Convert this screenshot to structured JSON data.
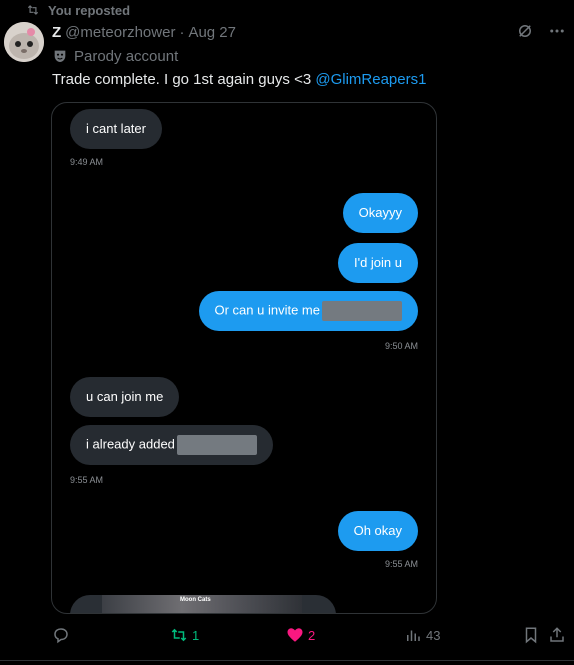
{
  "repost": {
    "label": "You reposted"
  },
  "author": {
    "display_name": "Z",
    "handle": "@meteorzhower",
    "separator": "·",
    "date": "Aug 27",
    "badge": "Parody account"
  },
  "post": {
    "text": "Trade complete. I go 1st again guys <3 ",
    "mention": "@GlimReapers1"
  },
  "conversation": {
    "messages": [
      {
        "side": "in",
        "text": "i cant later"
      },
      {
        "side": "time",
        "text": "9:49 AM"
      },
      {
        "side": "out",
        "text": "Okayyy"
      },
      {
        "side": "out",
        "text": "I'd join u"
      },
      {
        "side": "out",
        "text": "Or can u invite me"
      },
      {
        "side": "time",
        "text": "9:50 AM"
      },
      {
        "side": "in",
        "text": "u can join me"
      },
      {
        "side": "in",
        "text": "i already added"
      },
      {
        "side": "time",
        "text": "9:55 AM"
      },
      {
        "side": "out",
        "text": "Oh okay"
      },
      {
        "side": "time",
        "text": "9:55 AM"
      }
    ],
    "image_caption": "Moon Cats"
  },
  "actions": {
    "reply_count": "",
    "retweet_count": "1",
    "like_count": "2",
    "views_count": "43"
  },
  "colors": {
    "accent": "#1d9bf0",
    "retweet": "#00ba7c",
    "like": "#f91880",
    "muted": "#71767b"
  }
}
